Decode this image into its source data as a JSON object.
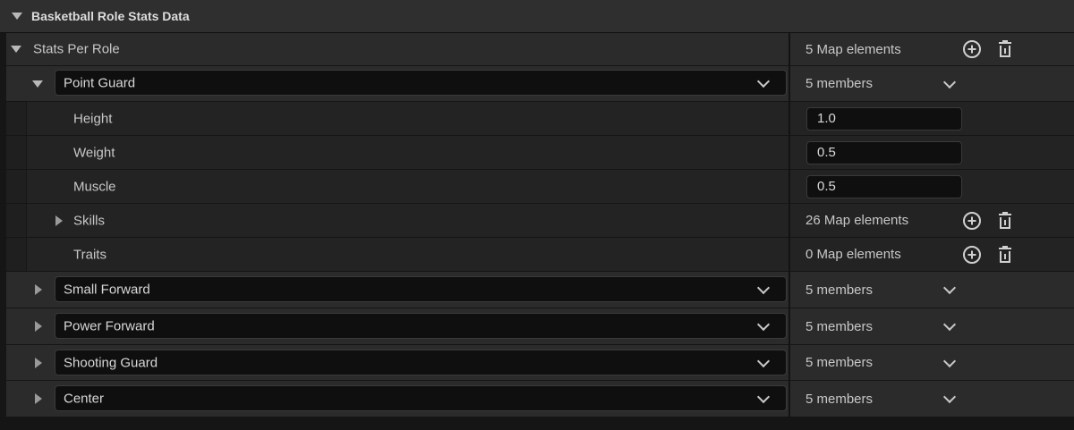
{
  "category": {
    "title": "Basketball Role Stats Data"
  },
  "stats_per_role": {
    "label": "Stats Per Role",
    "count": "5 Map elements"
  },
  "roles": [
    {
      "name": "Point Guard",
      "members": "5 members",
      "expanded": true
    },
    {
      "name": "Small Forward",
      "members": "5 members",
      "expanded": false
    },
    {
      "name": "Power Forward",
      "members": "5 members",
      "expanded": false
    },
    {
      "name": "Shooting Guard",
      "members": "5 members",
      "expanded": false
    },
    {
      "name": "Center",
      "members": "5 members",
      "expanded": false
    }
  ],
  "point_guard_fields": {
    "height": {
      "label": "Height",
      "value": "1.0"
    },
    "weight": {
      "label": "Weight",
      "value": "0.5"
    },
    "muscle": {
      "label": "Muscle",
      "value": "0.5"
    },
    "skills": {
      "label": "Skills",
      "count": "26 Map elements"
    },
    "traits": {
      "label": "Traits",
      "count": "0 Map elements"
    }
  },
  "icons": {
    "add": "plus-circle-icon",
    "delete": "trash-icon",
    "expand": "chevron-down-icon"
  }
}
